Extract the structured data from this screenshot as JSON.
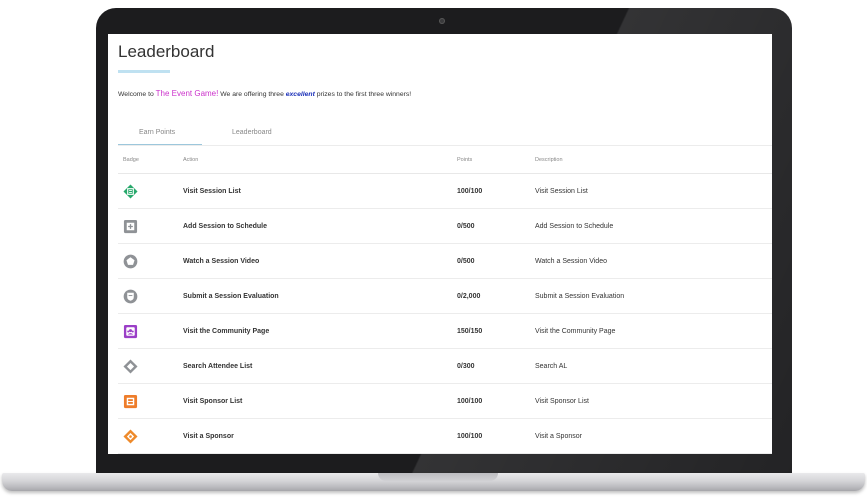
{
  "page": {
    "title": "Leaderboard",
    "welcome": {
      "pre": "Welcome to ",
      "brand": "The Event Game!",
      "mid": " We are offering three ",
      "emphasis": "excellent",
      "post": " prizes to the first three winners!"
    },
    "tabs": [
      {
        "label": "Earn Points",
        "active": true
      },
      {
        "label": "Leaderboard",
        "active": false
      }
    ]
  },
  "table": {
    "headers": {
      "badge": "Badge",
      "action": "Action",
      "points": "Points",
      "description": "Description"
    },
    "rows": [
      {
        "action": "Visit Session List",
        "points": "100/100",
        "description": "Visit Session List",
        "icon": "session-list-badge-icon",
        "color": "#27a86b"
      },
      {
        "action": "Add Session to Schedule",
        "points": "0/500",
        "description": "Add Session to Schedule",
        "icon": "schedule-badge-icon",
        "color": "#8f9296"
      },
      {
        "action": "Watch a Session Video",
        "points": "0/500",
        "description": "Watch a Session Video",
        "icon": "video-badge-icon",
        "color": "#8f9296"
      },
      {
        "action": "Submit a Session Evaluation",
        "points": "0/2,000",
        "description": "Submit a Session Evaluation",
        "icon": "evaluation-badge-icon",
        "color": "#8f9296"
      },
      {
        "action": "Visit the Community Page",
        "points": "150/150",
        "description": "Visit the Community Page",
        "icon": "community-badge-icon",
        "color": "#9b3fc7"
      },
      {
        "action": "Search Attendee List",
        "points": "0/300",
        "description": "Search AL",
        "icon": "attendee-search-badge-icon",
        "color": "#8f9296"
      },
      {
        "action": "Visit Sponsor List",
        "points": "100/100",
        "description": "Visit Sponsor List",
        "icon": "sponsor-list-badge-icon",
        "color": "#ee7d2b"
      },
      {
        "action": "Visit a Sponsor",
        "points": "100/100",
        "description": "Visit a Sponsor",
        "icon": "sponsor-badge-icon",
        "color": "#ee8a2b"
      }
    ]
  }
}
